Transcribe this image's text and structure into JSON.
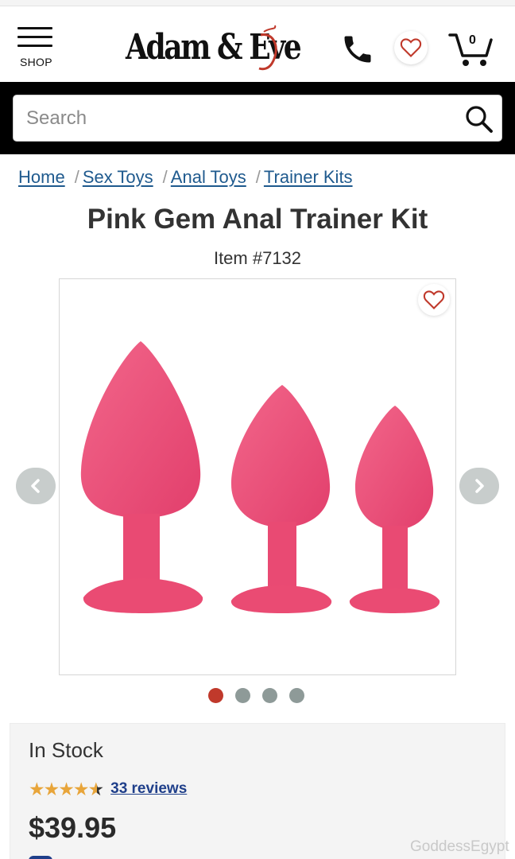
{
  "header": {
    "menu_label": "SHOP",
    "brand": "Adam & Eve",
    "cart_count": "0"
  },
  "search": {
    "placeholder": "Search"
  },
  "breadcrumb": [
    {
      "label": "Home"
    },
    {
      "label": "Sex Toys"
    },
    {
      "label": "Anal Toys"
    },
    {
      "label": "Trainer Kits"
    }
  ],
  "breadcrumb_separator": "/",
  "product": {
    "title": "Pink Gem Anal Trainer Kit",
    "item_number": "Item #7132",
    "gallery_images": 4,
    "active_image": 1,
    "stock_status": "In Stock",
    "rating": 4.5,
    "reviews_label": "33 reviews",
    "price": "$39.95"
  },
  "watermark": "GoddessEgypt",
  "colors": {
    "brand_red": "#c0392b",
    "link_blue": "#1f5a8e",
    "star_gold": "#e8a53a",
    "product_pink": "#ee4f79",
    "dot_inactive": "#8e9a98"
  },
  "icons": {
    "menu": "hamburger-icon",
    "phone": "phone-icon",
    "wishlist": "heart-icon",
    "cart": "cart-icon",
    "search": "search-icon",
    "prev": "chevron-left-icon",
    "next": "chevron-right-icon"
  }
}
